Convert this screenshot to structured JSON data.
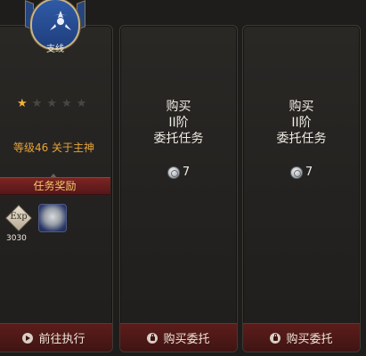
{
  "cards": [
    {
      "emblem_label": "支线",
      "rating": 1,
      "rating_max": 5,
      "quest_line": "等级46 关于主神",
      "reward_title": "任务奖励",
      "rewards": [
        {
          "icon": "exp-icon",
          "label": "Exp",
          "count": "3030"
        },
        {
          "icon": "armor-icon"
        }
      ],
      "button_label": "前往执行"
    },
    {
      "buy_lines": [
        "购买",
        "II阶",
        "委托任务"
      ],
      "cost": "7",
      "button_label": "购买委托"
    },
    {
      "buy_lines": [
        "购买",
        "II阶",
        "委托任务"
      ],
      "cost": "7",
      "button_label": "购买委托"
    }
  ],
  "colors": {
    "accent_gold": "#e6a43a",
    "button_red": "#5c1d1b",
    "star_on": "#f0b23a",
    "banner_blue": "#2f5aa6"
  }
}
